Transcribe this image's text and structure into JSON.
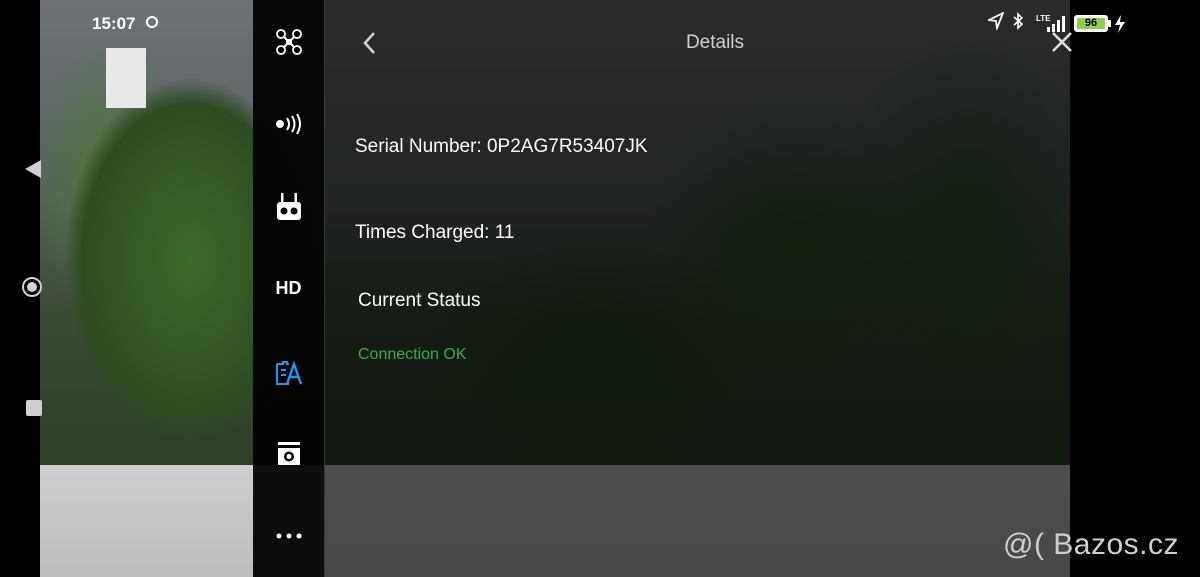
{
  "status_bar": {
    "time": "15:07",
    "battery_level": "96",
    "network": "LTE"
  },
  "side_menu": {
    "items": [
      {
        "icon": "drone-icon"
      },
      {
        "icon": "signal-icon"
      },
      {
        "icon": "remote-controller-icon"
      },
      {
        "icon": "hd-label",
        "label": "HD"
      },
      {
        "icon": "battery-icon",
        "active": true
      },
      {
        "icon": "camera-icon"
      },
      {
        "icon": "more-icon"
      }
    ]
  },
  "header": {
    "title": "Details"
  },
  "details": {
    "serial_number": "Serial Number: 0P2AG7R53407JK",
    "times_charged": "Times Charged: 11",
    "current_status_label": "Current Status",
    "current_status_value": "Connection OK"
  },
  "colors": {
    "active_icon": "#2196f3",
    "status_ok": "#2fb24a",
    "battery_fill": "#8bd14a"
  },
  "watermark": "@( Bazos.cz"
}
